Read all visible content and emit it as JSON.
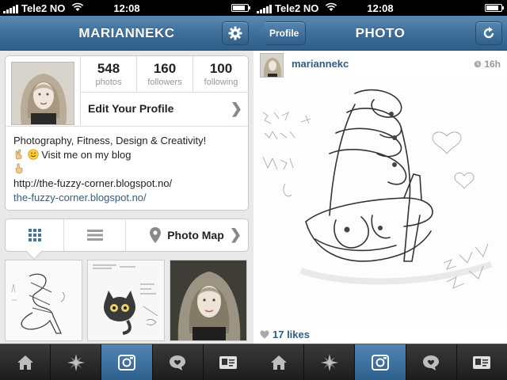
{
  "status_bar": {
    "carrier": "Tele2 NO",
    "time": "12:08"
  },
  "profile_screen": {
    "title": "MARIANNEKC",
    "stats": [
      {
        "value": "548",
        "label": "photos"
      },
      {
        "value": "160",
        "label": "followers"
      },
      {
        "value": "100",
        "label": "following"
      }
    ],
    "edit_profile_label": "Edit Your Profile",
    "bio": {
      "line1": "Photography, Fitness, Design & Creativity!",
      "line2": "Visit me on my blog",
      "line3": "http://the-fuzzy-corner.blogspot.no/",
      "link": "the-fuzzy-corner.blogspot.no/"
    },
    "segments": {
      "photo_map_label": "Photo Map"
    }
  },
  "photo_screen": {
    "title": "PHOTO",
    "back_label": "Profile",
    "username": "mariannekc",
    "time_ago": "16h",
    "likes": "17 likes"
  },
  "tab_bar": {
    "items": [
      "home-icon",
      "explore-icon",
      "camera-icon",
      "news-icon",
      "profile-icon"
    ],
    "active_index": 2
  },
  "colors": {
    "nav": "#3b6d98",
    "link": "#2e5e86",
    "tab_active": "#3f76a6"
  }
}
